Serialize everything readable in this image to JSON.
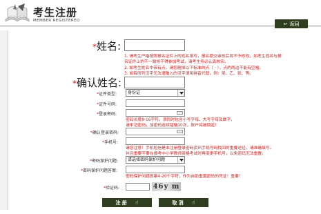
{
  "header": {
    "title": "考生注册",
    "subtitle": "MEMBER REGISTERED",
    "back_label": "返回"
  },
  "form": {
    "name_label": "姓名:",
    "name_notes": [
      "1. 请考生严格按照报名证件上的姓名填写，报名提交审核后将不予修改，如考生姓名与报",
      "名证件上的不一致将不得参加考试，请考生务必认真核实。",
      "2. 如考生姓名中带有点，请您删掉以下标准的点（ · ），点的两边不能有空格。",
      "3. 如有所列汉字无法请输入的汉字请用拼音代替，例：吴、乙、张、等。"
    ],
    "confirm_name_label": "确认姓名:",
    "id_type_label": "证件类型:",
    "id_type_value": "身份证",
    "id_number_label": "证件号码:",
    "password_label": "登录密码:",
    "password_note_1": "密码长度8-16字符，须同时包含小写字母、大写字母及数字，",
    "password_note_2": "请牢记密码，加密码连续错输10次，账户将被锁定！",
    "confirm_password_label": "确认登录密码:",
    "phone_label": "手机号:",
    "phone_note_1": "请您注意！手机短信是本注册登录密码资讯手机号码找回的重要途径，请准确填写。",
    "phone_note_2": "并且重要不要在报考中小学教师资格考试时再变更手机号，以免密码无法重置。",
    "security_question_label": "密码保护问题:",
    "security_question_value": "请选择密码保护问题",
    "security_answer_label": "密码保护问题答案:",
    "security_answer_note": "密码保护问题答案4-20个字符，作为自助重置密码的凭证！重要！",
    "captcha_label": "验证码:",
    "captcha_text": "46y m",
    "submit_label": "注 册",
    "cancel_label": "取 消"
  },
  "colors": {
    "accent_dark": "#2f3e1e",
    "required_red": "#c81e1e"
  }
}
